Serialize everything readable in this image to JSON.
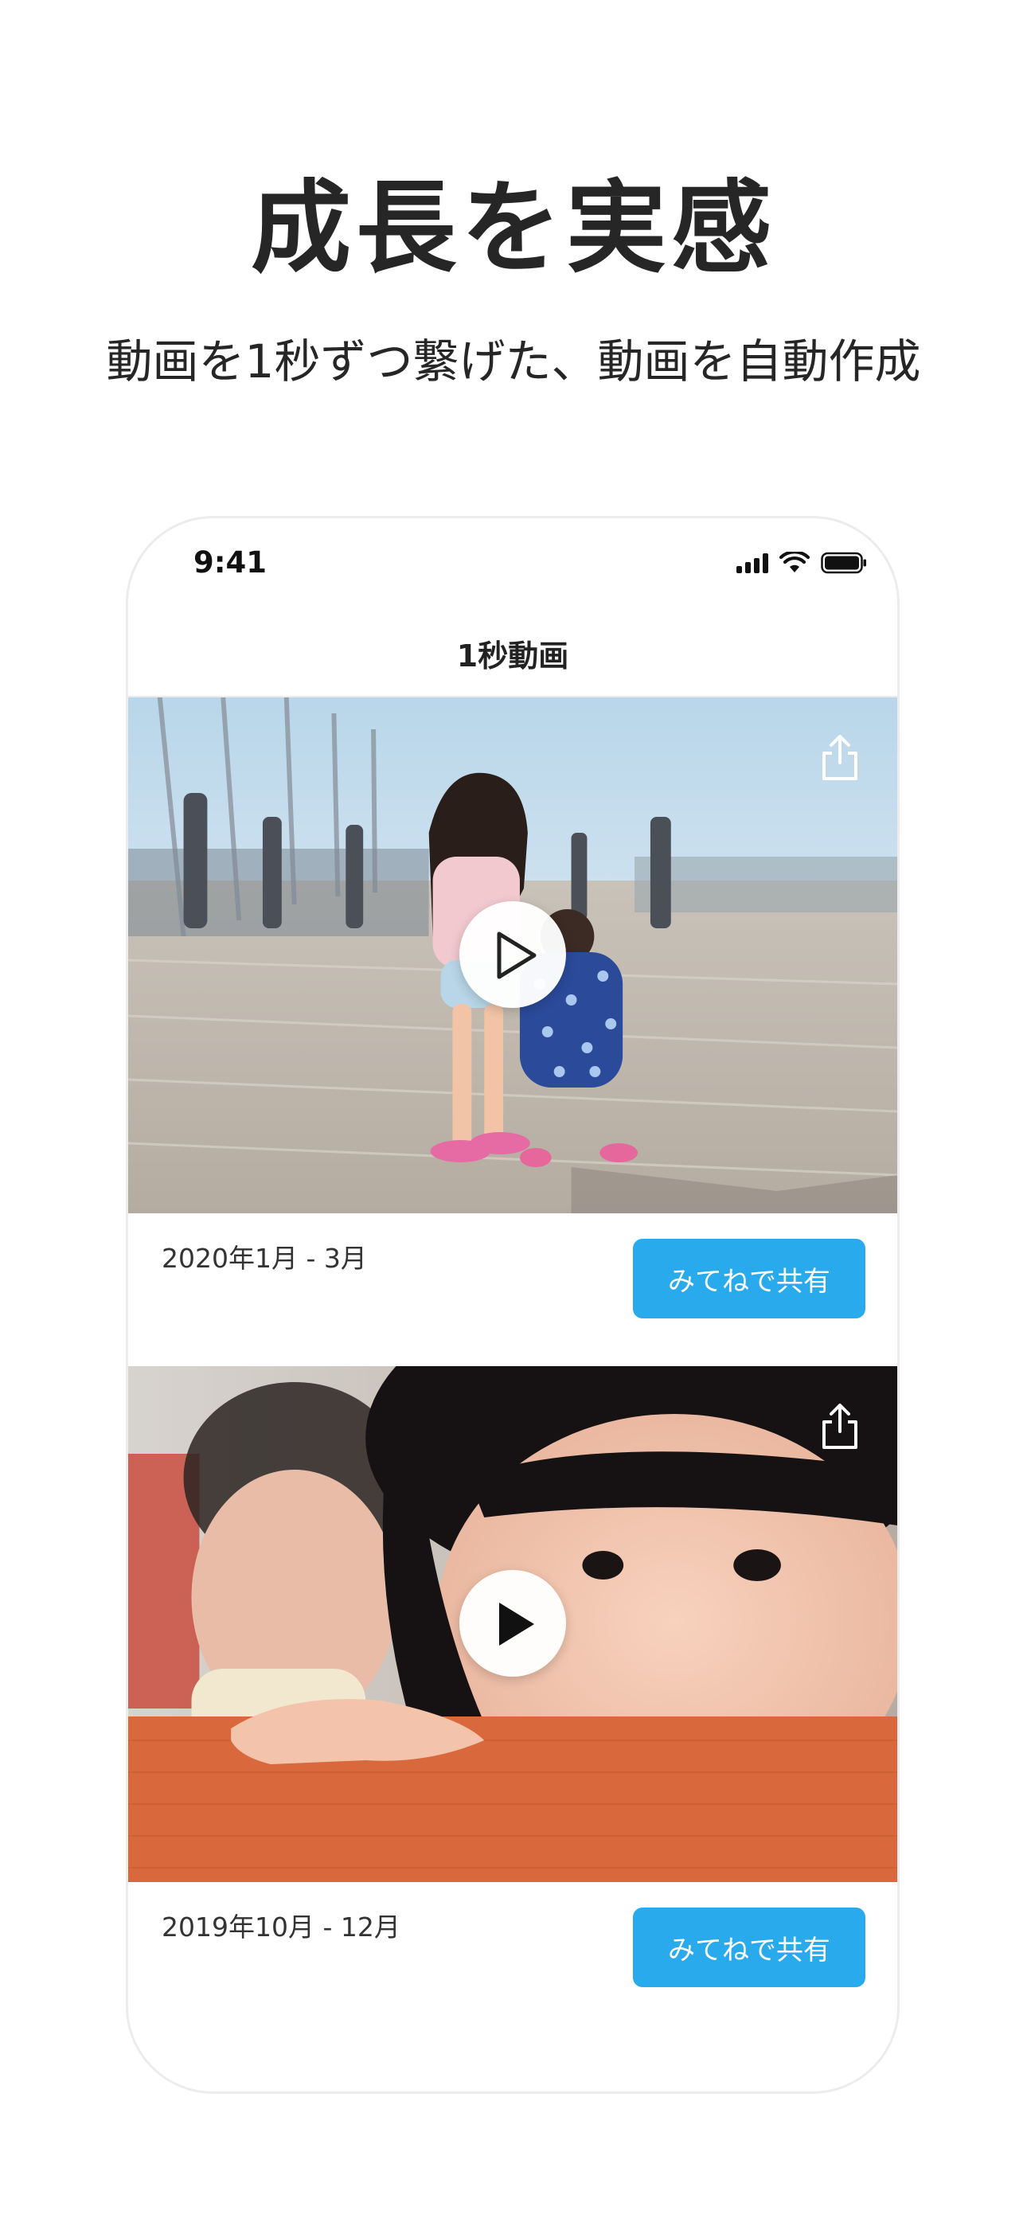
{
  "headline": "成長を実感",
  "subheadline": "動画を1秒ずつ繋げた、動画を自動作成",
  "status_bar": {
    "time": "9:41",
    "icons": [
      "signal-icon",
      "wifi-icon",
      "battery-icon"
    ]
  },
  "nav": {
    "title": "1秒動画"
  },
  "videos": [
    {
      "date_range": "2020年1月 - 3月",
      "share_label": "みてねで共有",
      "icons": [
        "play-icon",
        "share-icon"
      ]
    },
    {
      "date_range": "2019年10月 - 12月",
      "share_label": "みてねで共有",
      "icons": [
        "play-icon",
        "share-icon"
      ]
    }
  ],
  "colors": {
    "accent": "#29aaed",
    "text": "#262626"
  }
}
